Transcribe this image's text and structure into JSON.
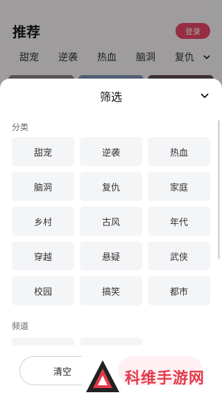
{
  "background": {
    "title": "推荐",
    "login_label": "登录",
    "tabs": [
      "甜宠",
      "逆袭",
      "热血",
      "脑洞",
      "复仇"
    ]
  },
  "sheet": {
    "title": "筛选",
    "sections": [
      {
        "title": "分类",
        "items": [
          "甜宠",
          "逆袭",
          "热血",
          "脑洞",
          "复仇",
          "家庭",
          "乡村",
          "古风",
          "年代",
          "穿越",
          "悬疑",
          "武侠",
          "校园",
          "搞笑",
          "都市"
        ]
      },
      {
        "title": "频道",
        "items": [
          "",
          ""
        ]
      }
    ]
  },
  "footer": {
    "clear_label": "清空",
    "confirm_label": ""
  },
  "watermark": {
    "text": "科维手游网"
  },
  "colors": {
    "accent": "#ef3f68",
    "watermark_red": "#e23a4a",
    "chip_bg": "#f4f5f7"
  }
}
